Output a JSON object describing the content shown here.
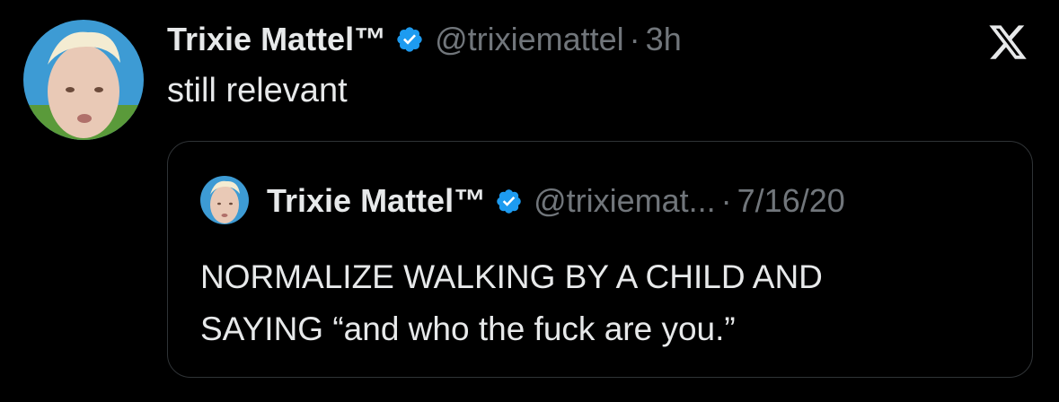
{
  "tweet": {
    "author": {
      "name": "Trixie Mattel™",
      "handle": "@trixiemattel",
      "verified": true,
      "avatar_icon": "user-avatar-photo"
    },
    "separator": "·",
    "time": "3h",
    "text": "still relevant",
    "platform_icon": "x-logo-icon"
  },
  "quote": {
    "author": {
      "name": "Trixie Mattel™",
      "handle": "@trixiemat...",
      "verified": true,
      "avatar_icon": "user-avatar-photo"
    },
    "separator": "·",
    "time": "7/16/20",
    "text_line1": "NORMALIZE WALKING BY A CHILD AND",
    "text_line2": "SAYING “and who the fuck are you.”"
  },
  "colors": {
    "background": "#000000",
    "text": "#e7e9ea",
    "muted": "#71767b",
    "verified_blue": "#1d9bf0",
    "border": "#2f3336"
  }
}
